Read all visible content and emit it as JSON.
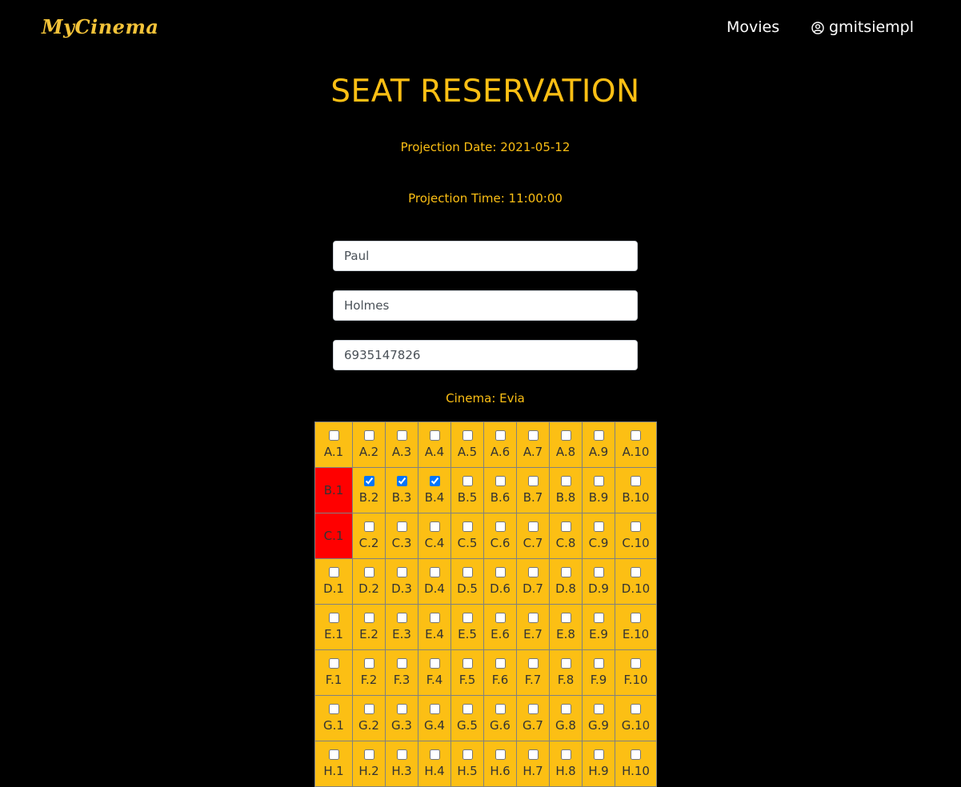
{
  "nav": {
    "logo": "MyCinema",
    "movies_label": "Movies",
    "username": "gmitsiempl"
  },
  "page": {
    "title": "SEAT RESERVATION",
    "projection_date": "Projection Date: 2021-05-12",
    "projection_time": "Projection Time: 11:00:00",
    "cinema": "Cinema: Evia"
  },
  "form": {
    "first_name": "Paul",
    "last_name": "Holmes",
    "phone": "6935147826"
  },
  "colors": {
    "accent": "#fcbf14",
    "taken": "#ff0000",
    "background": "#000000"
  },
  "seats": {
    "columns": 10,
    "rows": [
      {
        "row": "A",
        "taken": [],
        "selected": []
      },
      {
        "row": "B",
        "taken": [
          1
        ],
        "selected": [
          2,
          3,
          4
        ]
      },
      {
        "row": "C",
        "taken": [
          1
        ],
        "selected": []
      },
      {
        "row": "D",
        "taken": [],
        "selected": []
      },
      {
        "row": "E",
        "taken": [],
        "selected": []
      },
      {
        "row": "F",
        "taken": [],
        "selected": []
      },
      {
        "row": "G",
        "taken": [],
        "selected": []
      },
      {
        "row": "H",
        "taken": [],
        "selected": []
      }
    ]
  }
}
